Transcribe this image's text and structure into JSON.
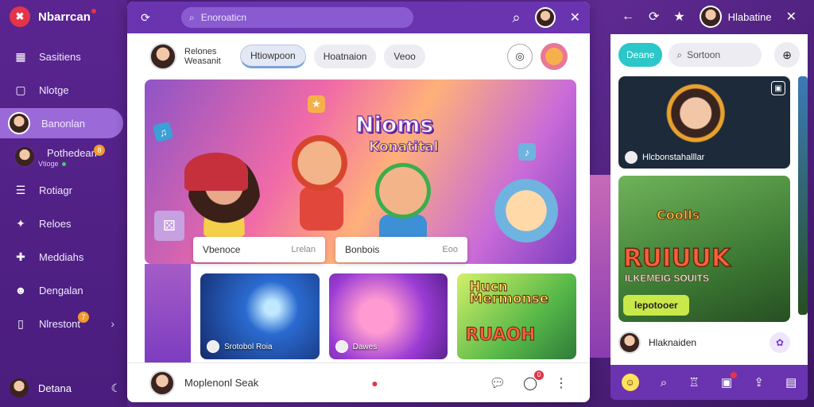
{
  "brand": {
    "name": "Nbarrcan"
  },
  "sidebar": {
    "items": [
      {
        "label": "Sasitiens",
        "icon": "calendar-icon"
      },
      {
        "label": "Nlotge",
        "icon": "chat-icon"
      },
      {
        "label": "Banonlan",
        "icon": "avatar"
      },
      {
        "label": "Pothedean",
        "sub": "Vtioge",
        "icon": "avatar",
        "badge": "8"
      },
      {
        "label": "Rotiagr",
        "icon": "list-icon"
      },
      {
        "label": "Reloes",
        "icon": "star-icon"
      },
      {
        "label": "Meddiahs",
        "icon": "puzzle-icon"
      },
      {
        "label": "Dengalan",
        "icon": "users-icon"
      },
      {
        "label": "Nlrestont",
        "icon": "bookmark-icon",
        "badge": "7"
      }
    ],
    "footer_name": "Detana"
  },
  "main": {
    "search_placeholder": "Enoroaticn",
    "profile": {
      "name_line1": "Relones",
      "name_line2": "Weasanit"
    },
    "tabs": [
      "Htiowpoon",
      "Hoatnaion",
      "Veoo"
    ],
    "hero": {
      "title": "Nioms",
      "subtitle": "Konatital"
    },
    "info_cards": [
      {
        "title": "Vbenoce",
        "sub": "Lrelan"
      },
      {
        "title": "Bonbois",
        "sub": "Eoo"
      }
    ],
    "thumbs": [
      {
        "label": "Srotobol Roia"
      },
      {
        "label": "Dawes"
      },
      {
        "title": "Hucn Mermonse",
        "title2": "RUAOH"
      }
    ],
    "bottom": {
      "text": "Moplenonl Seak"
    }
  },
  "right_panel": {
    "top_name": "Hlabatine",
    "chip": "Deane",
    "search_placeholder": "Sortoon",
    "card1_label": "Hlcbonstahalllar",
    "card2": {
      "t1": "Coolls",
      "t2": "RUIUUK",
      "t3": "ILKEMEIG SOUITS",
      "button": "lepotooer"
    },
    "user_name": "Hlaknaiden"
  },
  "colors": {
    "accent": "#6a34b0",
    "sidebar": "#5a2590",
    "teal": "#2cc7c8",
    "danger": "#e3344a"
  }
}
